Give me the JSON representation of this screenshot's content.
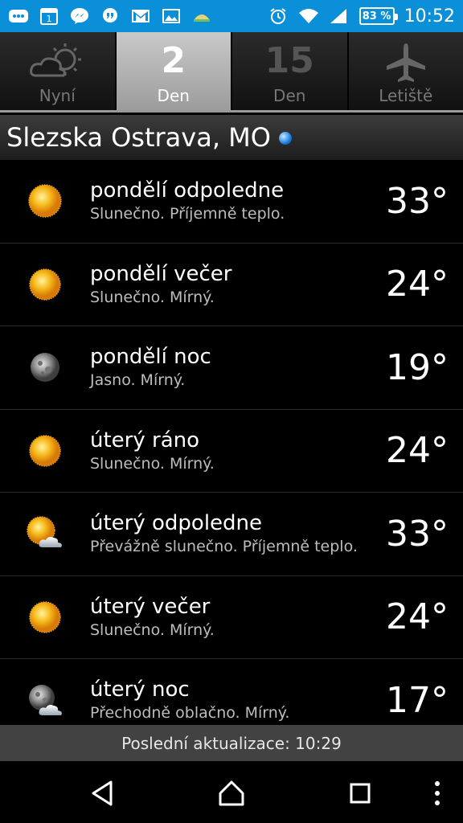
{
  "status_bar": {
    "battery": "83 %",
    "time": "10:52",
    "left_icons": [
      "messages-icon",
      "calendar-icon",
      "messenger-icon",
      "hangouts-icon",
      "gmail-icon",
      "gallery-icon",
      "weather-app-icon"
    ],
    "right_icons": [
      "alarm-icon",
      "wifi-icon",
      "signal-icon"
    ],
    "calendar_day": "1"
  },
  "tabs": [
    {
      "label": "Nyní",
      "icon": "partly-cloudy-icon",
      "active": false
    },
    {
      "number": "2",
      "label": "Den",
      "active": true
    },
    {
      "number": "15",
      "label": "Den",
      "active": false
    },
    {
      "label": "Letiště",
      "icon": "airplane-icon",
      "active": false
    }
  ],
  "location": {
    "name": "Slezska Ostrava, MO"
  },
  "forecast": [
    {
      "title": "pondělí odpoledne",
      "desc": "Slunečno. Příjemně teplo.",
      "temp": "33°",
      "icon": "sun-icon"
    },
    {
      "title": "pondělí večer",
      "desc": "Slunečno. Mírný.",
      "temp": "24°",
      "icon": "sun-icon"
    },
    {
      "title": "pondělí noc",
      "desc": "Jasno. Mírný.",
      "temp": "19°",
      "icon": "moon-icon"
    },
    {
      "title": "úterý ráno",
      "desc": "Slunečno. Mírný.",
      "temp": "24°",
      "icon": "sun-icon"
    },
    {
      "title": "úterý odpoledne",
      "desc": "Převážně slunečno. Příjemně teplo.",
      "temp": "33°",
      "icon": "sun-cloud-icon"
    },
    {
      "title": "úterý večer",
      "desc": "Slunečno. Mírný.",
      "temp": "24°",
      "icon": "sun-icon"
    },
    {
      "title": "úterý noc",
      "desc": "Přechodně oblačno. Mírný.",
      "temp": "17°",
      "icon": "moon-cloud-icon"
    }
  ],
  "footer": {
    "update_text": "Poslední aktualizace: 10:29"
  },
  "colors": {
    "status_bar": "#0a8fd8",
    "active_tab": "#b0b0b0",
    "background": "#000000",
    "footer": "#424242"
  }
}
